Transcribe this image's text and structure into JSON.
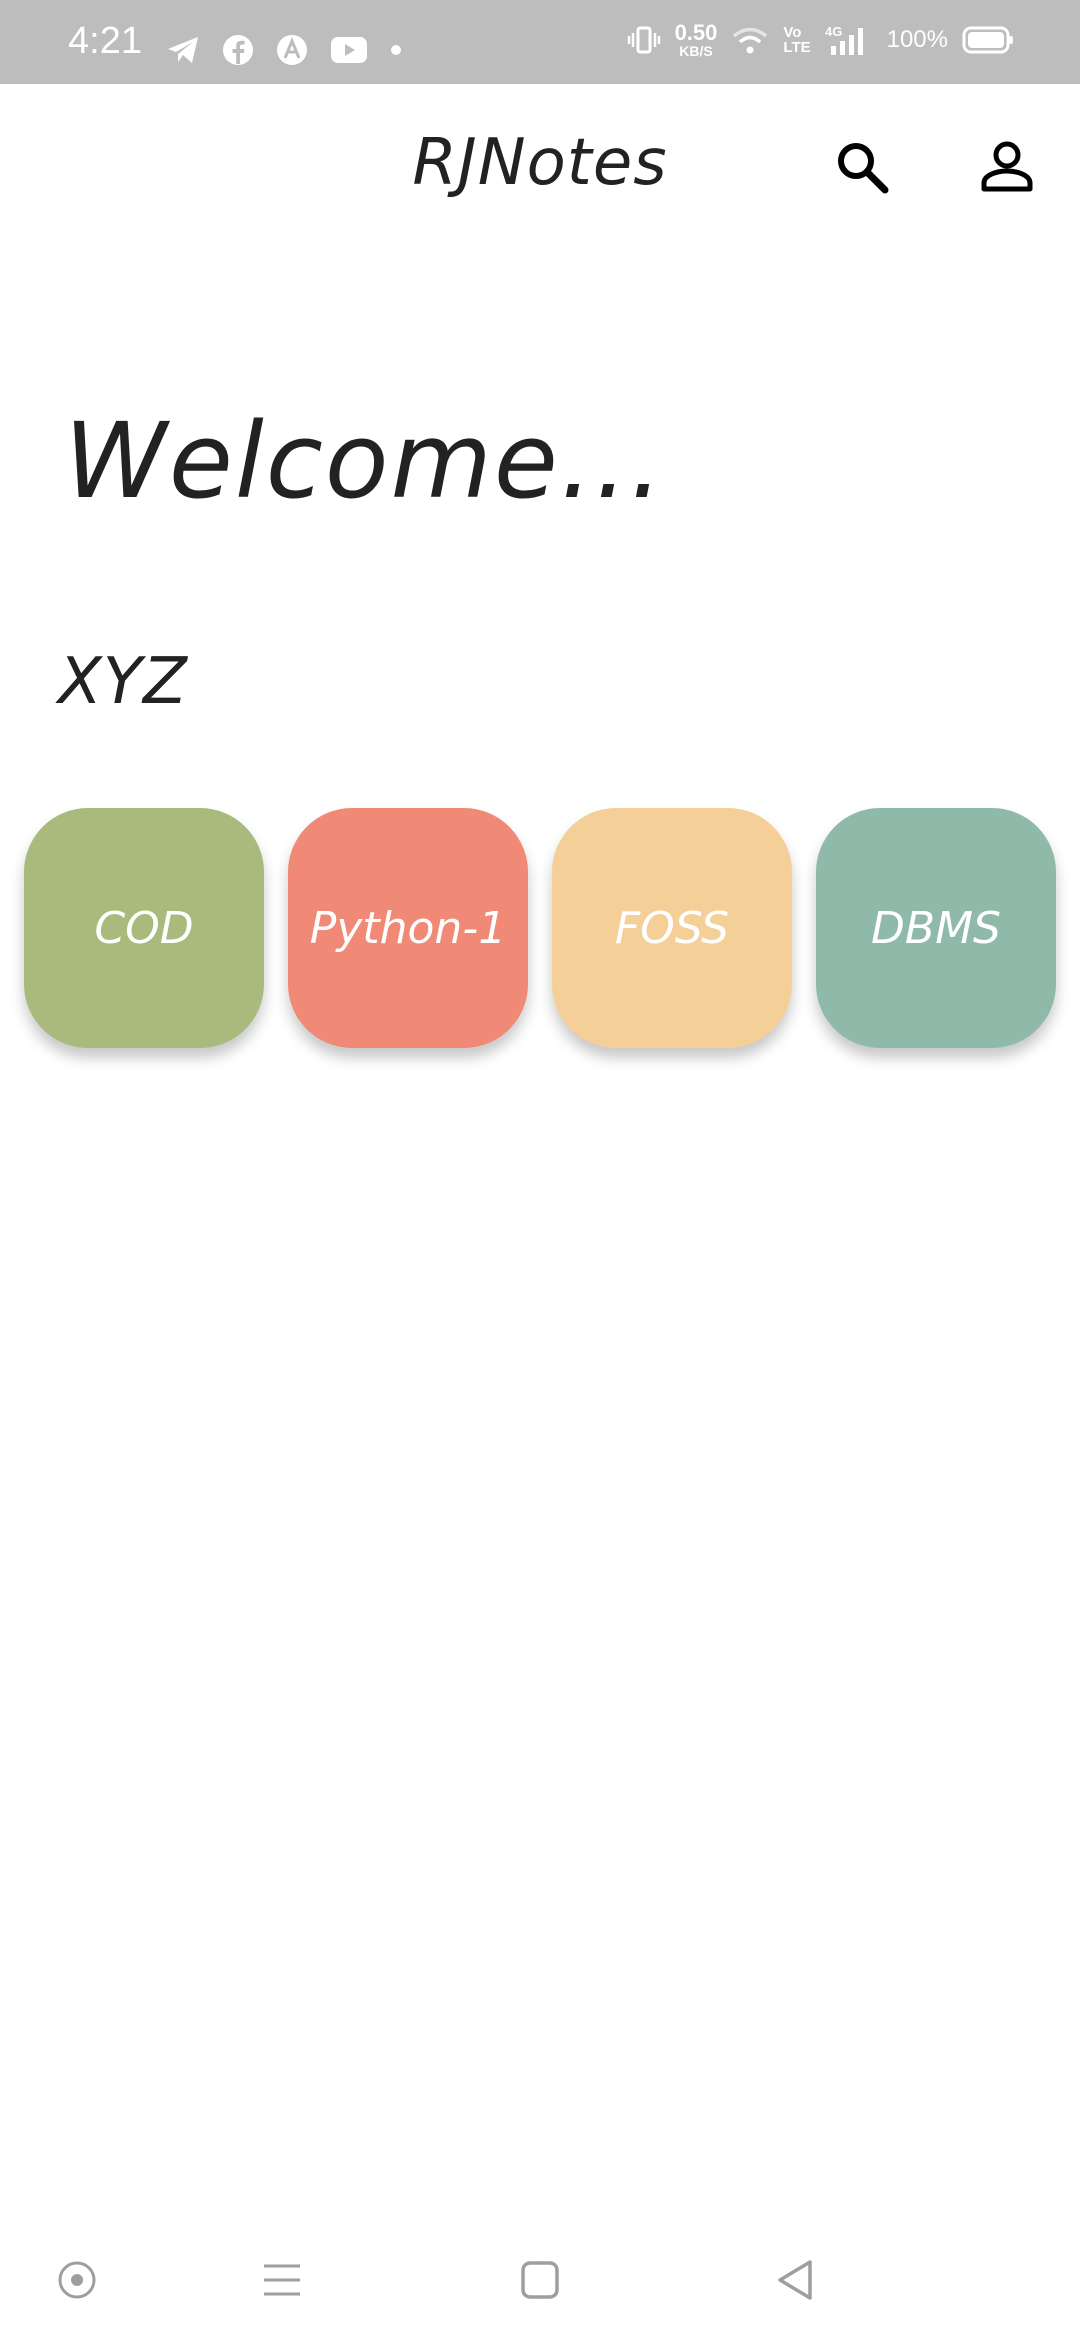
{
  "status_bar": {
    "time": "4:21",
    "net_speed_value": "0.50",
    "net_speed_unit": "KB/S",
    "volte_top": "Vo",
    "volte_bottom": "LTE",
    "network": "4G",
    "battery": "100%",
    "icons": [
      "telegram-icon",
      "facebook-icon",
      "arc-icon",
      "youtube-icon",
      "dot-icon",
      "vibrate-icon",
      "wifi-icon",
      "signal-icon",
      "battery-icon"
    ]
  },
  "app_bar": {
    "title": "RJNotes",
    "icons": [
      "search-icon",
      "account-icon"
    ]
  },
  "main": {
    "welcome": "Welcome...",
    "username": "XYZ",
    "subjects": [
      {
        "label": "COD",
        "color": "#a8ba7c"
      },
      {
        "label": "Python-1",
        "color": "#f08975"
      },
      {
        "label": "FOSS",
        "color": "#f5cf98"
      },
      {
        "label": "DBMS",
        "color": "#8fbaa9"
      }
    ]
  },
  "nav_bar": {
    "icons": [
      "assistant-icon",
      "menu-icon",
      "home-square-icon",
      "back-icon"
    ],
    "color": "#9e9e9e"
  }
}
